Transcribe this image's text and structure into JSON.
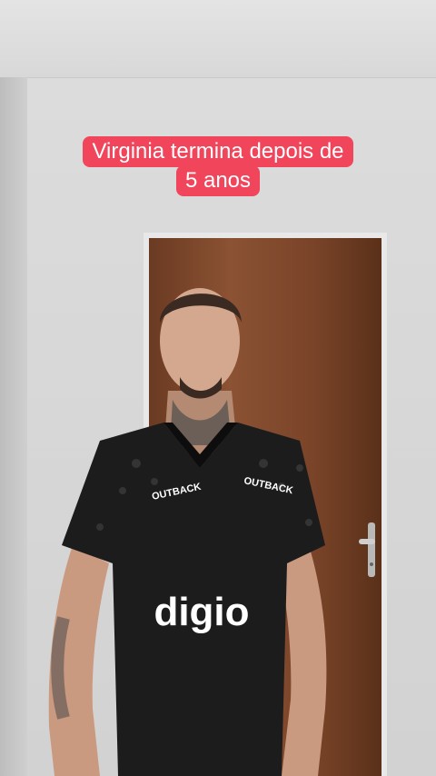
{
  "caption": {
    "line1": "Virginia termina depois de",
    "line2": "5 anos",
    "background": "#f0455a",
    "text_color": "#ffffff"
  },
  "scene": {
    "jersey_sponsor_main": "digio",
    "jersey_sponsor_chest": "OUTBACK",
    "door_color": "#7a4429",
    "wall_color": "#d6d6d6"
  }
}
